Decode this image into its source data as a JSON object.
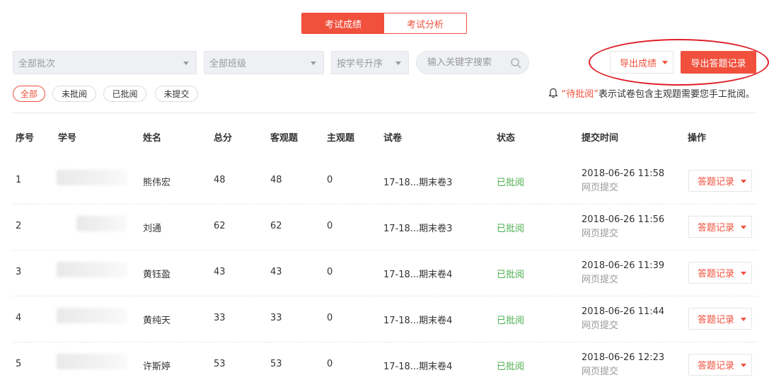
{
  "tabs": [
    {
      "label": "考试成绩",
      "active": true
    },
    {
      "label": "考试分析",
      "active": false
    }
  ],
  "filters": {
    "batch": "全部批次",
    "class": "全部班级",
    "sort": "按学号升序",
    "search_placeholder": "输入关键字搜索"
  },
  "actions": {
    "export_score": "导出成绩",
    "export_record": "导出答题记录"
  },
  "status_filters": [
    "全部",
    "未批阅",
    "已批阅",
    "未提交"
  ],
  "notice": {
    "highlight": "“待批阅”",
    "text": "表示试卷包含主观题需要您手工批阅。"
  },
  "colors": {
    "accent": "#f0503c",
    "status_reviewed": "#4caf50",
    "annotation_ellipse": "#e0202a"
  },
  "table": {
    "headers": [
      "序号",
      "学号",
      "姓名",
      "总分",
      "客观题",
      "主观题",
      "试卷",
      "状态",
      "提交时间",
      "操作"
    ],
    "rows": [
      {
        "index": "1",
        "name": "熊伟宏",
        "total": "48",
        "objective": "48",
        "subjective": "0",
        "paper": "17-18...期末卷3",
        "status": "已批阅",
        "time": "2018-06-26 11:58",
        "method": "网页提交",
        "action": "答题记录"
      },
      {
        "index": "2",
        "name": "刘通",
        "total": "62",
        "objective": "62",
        "subjective": "0",
        "paper": "17-18...期末卷3",
        "status": "已批阅",
        "time": "2018-06-26 11:56",
        "method": "网页提交",
        "action": "答题记录"
      },
      {
        "index": "3",
        "name": "黄钰盈",
        "total": "43",
        "objective": "43",
        "subjective": "0",
        "paper": "17-18...期末卷4",
        "status": "已批阅",
        "time": "2018-06-26 11:39",
        "method": "网页提交",
        "action": "答题记录"
      },
      {
        "index": "4",
        "name": "黄纯天",
        "total": "33",
        "objective": "33",
        "subjective": "0",
        "paper": "17-18...期末卷4",
        "status": "已批阅",
        "time": "2018-06-26 11:44",
        "method": "网页提交",
        "action": "答题记录"
      },
      {
        "index": "5",
        "name": "许斯婷",
        "total": "53",
        "objective": "53",
        "subjective": "0",
        "paper": "17-18...期末卷4",
        "status": "已批阅",
        "time": "2018-06-26 12:23",
        "method": "网页提交",
        "action": "答题记录"
      }
    ]
  }
}
